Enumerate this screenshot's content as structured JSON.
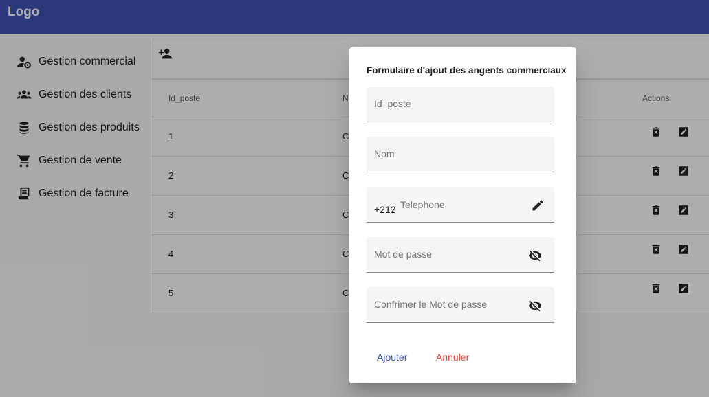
{
  "header": {
    "logo": "Logo"
  },
  "sidebar": {
    "items": [
      {
        "label": "Gestion commercial",
        "icon": "manage-accounts-icon"
      },
      {
        "label": "Gestion des clients",
        "icon": "groups-icon"
      },
      {
        "label": "Gestion des produits",
        "icon": "database-icon"
      },
      {
        "label": "Gestion de vente",
        "icon": "shopping-cart-icon"
      },
      {
        "label": "Gestion de facture",
        "icon": "receipt-icon"
      }
    ]
  },
  "table": {
    "headers": {
      "id": "Id_poste",
      "nom": "No",
      "actions": "Actions"
    },
    "rows": [
      {
        "id": "1",
        "nom": "Cl"
      },
      {
        "id": "2",
        "nom": "Cl"
      },
      {
        "id": "3",
        "nom": "Cl"
      },
      {
        "id": "4",
        "nom": "Cl"
      },
      {
        "id": "5",
        "nom": "Cl"
      }
    ]
  },
  "dialog": {
    "title": "Formulaire d'ajout des angents commerciaux",
    "fields": {
      "id_poste": "Id_poste",
      "nom": "Nom",
      "telephone_prefix": "+212",
      "telephone": "Telephone",
      "password": "Mot de passe",
      "confirm_password": "Confrimer le Mot de passe"
    },
    "buttons": {
      "ok": "Ajouter",
      "cancel": "Annuler"
    }
  },
  "colors": {
    "primary": "#3f51b5",
    "warn": "#f44336"
  }
}
